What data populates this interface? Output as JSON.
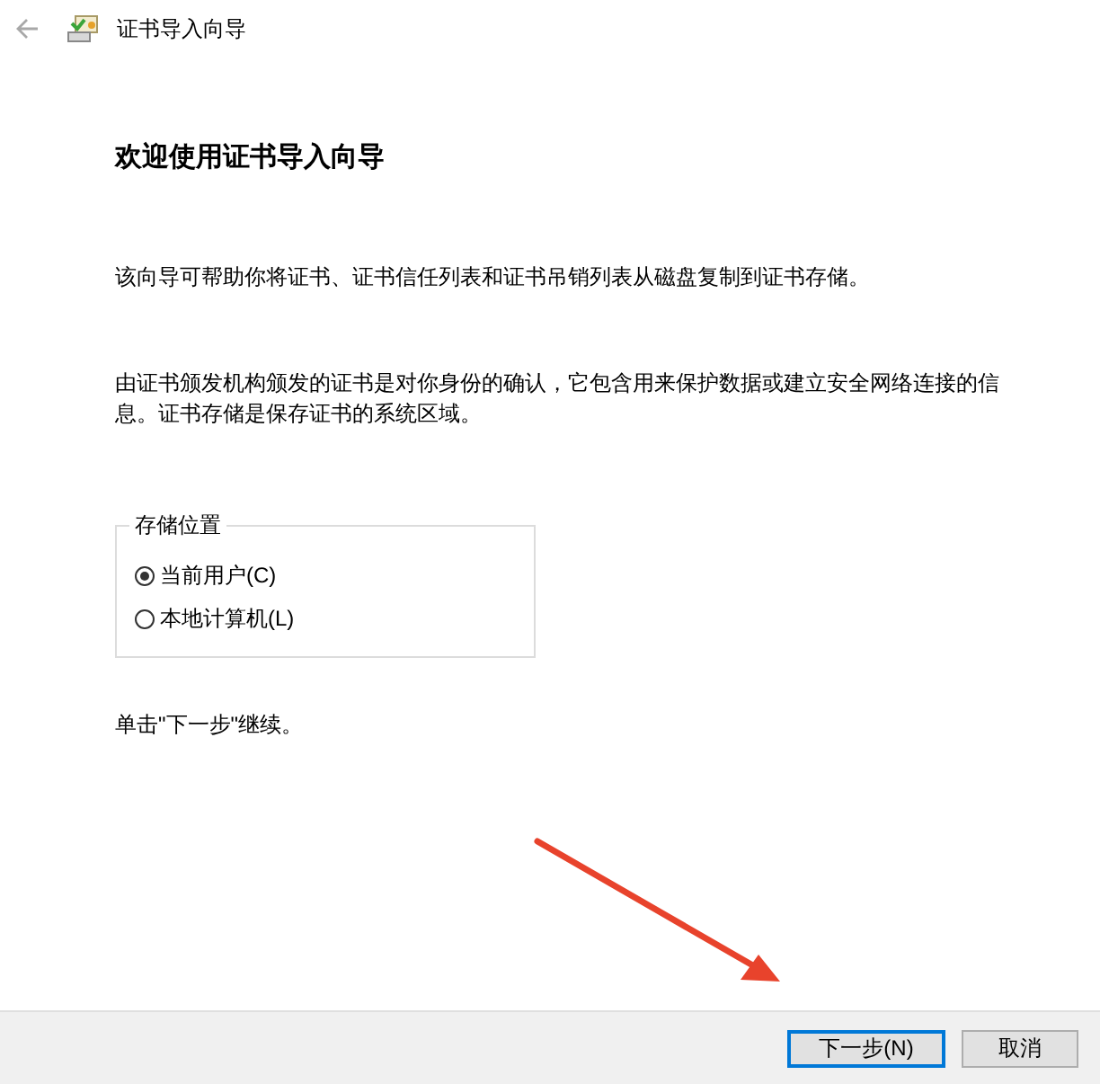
{
  "window": {
    "title": "证书导入向导"
  },
  "heading": "欢迎使用证书导入向导",
  "paragraphs": [
    "该向导可帮助你将证书、证书信任列表和证书吊销列表从磁盘复制到证书存储。",
    "由证书颁发机构颁发的证书是对你身份的确认，它包含用来保护数据或建立安全网络连接的信息。证书存储是保存证书的系统区域。"
  ],
  "store_location": {
    "label": "存储位置",
    "options": [
      {
        "label": "当前用户(C)",
        "selected": true
      },
      {
        "label": "本地计算机(L)",
        "selected": false
      }
    ]
  },
  "hint": "单击\"下一步\"继续。",
  "buttons": [
    {
      "label": "下一步(N)",
      "kind": "default"
    },
    {
      "label": "取消",
      "kind": "normal"
    }
  ]
}
